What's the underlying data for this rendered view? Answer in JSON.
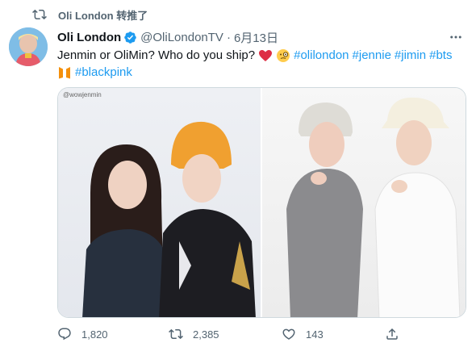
{
  "retweet": {
    "label": "Oli London 转推了",
    "icon": "retweet-icon"
  },
  "tweet": {
    "author_name": "Oli London",
    "handle": "@OliLondonTV",
    "separator": "·",
    "date": "6月13日",
    "text_line1": "Jenmin or OliMin? Who do you ship?",
    "hashtags_line1": [
      "#olilondon",
      "#jennie",
      "#jimin",
      "#bts"
    ],
    "hashtags_line2": [
      "#blackpink"
    ],
    "emojis": [
      "red-heart-emoji",
      "face-with-monocle-emoji",
      "orange-heart-bts-emoji"
    ]
  },
  "media": {
    "watermark": "@wowjenmin"
  },
  "actions": {
    "reply_count": "1,820",
    "retweet_count": "2,385",
    "like_count": "143"
  },
  "colors": {
    "link": "#1d9bf0",
    "muted": "#536471",
    "verified": "#1d9bf0",
    "heart": "#e0245e"
  }
}
